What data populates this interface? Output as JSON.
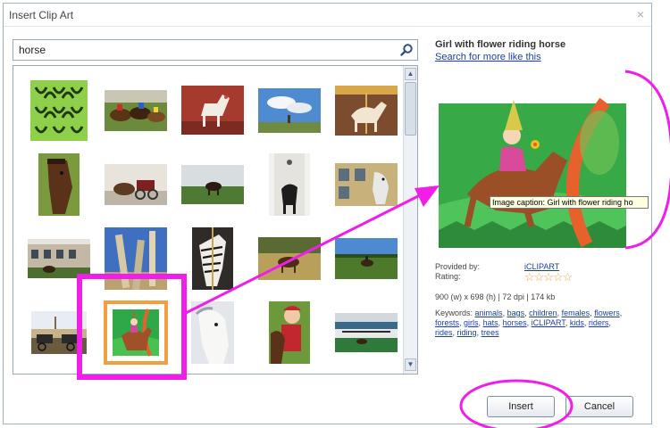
{
  "dialog": {
    "title": "Insert Clip Art",
    "close_glyph": "×"
  },
  "search": {
    "query": "horse",
    "icon": "search-icon"
  },
  "results": {
    "thumbnails": [
      "horseshoe-pattern",
      "horse-race",
      "wooden-horse-toy",
      "horse-sky-clouds",
      "carousel-horse",
      "horse-head-brown",
      "horse-carriage-street",
      "horse-grazing-field",
      "horse-building",
      "horse-white-wall",
      "stable-building",
      "fence-posts",
      "carousel-zebra",
      "horse-field-trees",
      "horse-rider-field",
      "horse-carriages-city",
      "girl-flower-horse-selected",
      "white-horse",
      "girl-with-horse",
      "racetrack-scene"
    ],
    "selected_index": 16,
    "highlight_color": "#f01ee8"
  },
  "details": {
    "title": "Girl with flower riding horse",
    "more_link": "Search for more like this",
    "caption_tooltip": "Image caption: Girl with flower riding ho",
    "provided_by_label": "Provided by:",
    "provider": "iCLIPART",
    "rating_label": "Rating:",
    "stars": "☆☆☆☆☆",
    "dimensions": "900 (w) x 698 (h) | 72 dpi | 174 kb",
    "keywords_label": "Keywords:",
    "keywords": [
      "animals",
      "bags",
      "children",
      "females",
      "flowers",
      "forests",
      "girls",
      "hats",
      "horses",
      "iCLIPART",
      "kids",
      "riders",
      "rides",
      "riding",
      "trees"
    ]
  },
  "buttons": {
    "insert": "Insert",
    "cancel": "Cancel"
  },
  "colors": {
    "annotation": "#f01ee8",
    "link": "#1a3fa8",
    "thumb_selected_border": "#f0a040"
  }
}
